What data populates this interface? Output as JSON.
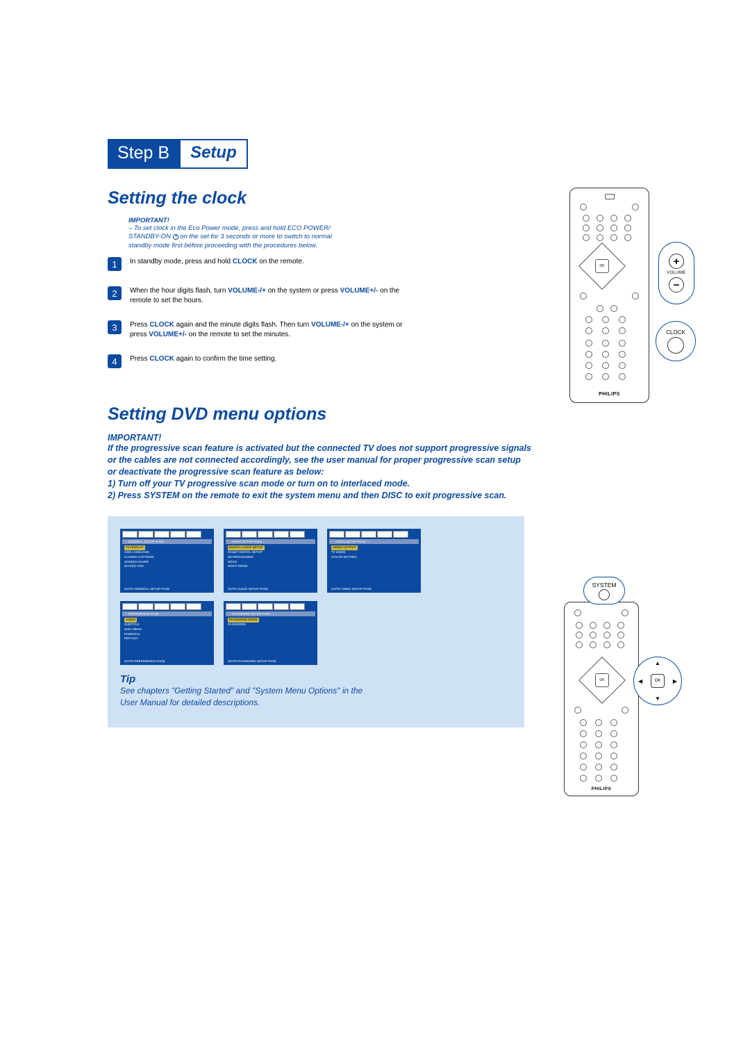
{
  "step_badge": {
    "left": "Step B",
    "right": "Setup"
  },
  "clock": {
    "heading": "Setting the clock",
    "important_label": "IMPORTANT!",
    "important_text_1": "– To set clock in the Eco Power mode, press and hold ECO POWER/",
    "important_text_2a": "STANDBY-ON ",
    "important_text_2b": " on the set for 3 seconds or more to switch to normal",
    "important_text_3": "standby mode first before proceeding with the procedures below.",
    "steps": {
      "s1a": "In standby mode, press and hold ",
      "s1b": "CLOCK",
      "s1c": " on the remote.",
      "s2a": "When the hour digits flash, turn ",
      "s2b": "VOLUME-/+",
      "s2c": " on the system or press ",
      "s2d": "VOLUME+/-",
      "s2e": " on the remote to set the hours.",
      "s3a": "Press ",
      "s3b": "CLOCK",
      "s3c": " again and the minute digits flash. Then turn ",
      "s3d": "VOLUME-/+",
      "s3e": " on the system or press ",
      "s3f": "VOLUME+/-",
      "s3g": " on the remote to set the minutes.",
      "s4a": "Press ",
      "s4b": "CLOCK",
      "s4c": " again to confirm the time setting."
    },
    "nums": {
      "n1": "1",
      "n2": "2",
      "n3": "3",
      "n4": "4"
    },
    "remote_brand": "PHILIPS",
    "ok_label": "OK",
    "volume_label": "VOLUME",
    "plus": "+",
    "minus": "−",
    "clock_label": "CLOCK"
  },
  "dvd": {
    "heading": "Setting DVD menu options",
    "important_label": "IMPORTANT!",
    "p1": "If the progressive scan feature is activated but the connected TV does not support progressive signals or the cables are not connected accordingly, see the user manual for proper progressive scan setup or deactivate the progressive scan feature as below:",
    "p2": "1) Turn off your TV progressive scan mode or turn on to interlaced mode.",
    "p3": "2) Press SYSTEM on the remote to exit the system menu and then DISC to exit progressive scan.",
    "system_label": "SYSTEM",
    "ok_label": "OK",
    "remote_brand": "PHILIPS",
    "panels": {
      "general": {
        "title": "- - GENERAL SETUP PAGE - -",
        "items": [
          "TV DISPLAY",
          "OSD LANGUAGE",
          "CLOSED CAPTIONS",
          "SCREEN SAVER",
          "DIVX(R) VOD"
        ],
        "footer": "GOTO GENERAL SETUP PAGE"
      },
      "audio": {
        "title": "- - AUDIO SETUP PAGE - -",
        "items": [
          "DIGITAL AUDIO SETUP",
          "DOLBY DIGITAL SETUP",
          "3D PROCESSING",
          "HDCD",
          "NIGHT MODE"
        ],
        "footer": "GOTO AUDIO SETUP PAGE"
      },
      "video": {
        "title": "- - VIDEO SETUP PAGE - -",
        "items": [
          "VIDEO OUTPUT",
          "TV MODE",
          "COLOR SETTING"
        ],
        "footer": "GOTO VIDEO SETUP PAGE"
      },
      "preference": {
        "title": "- - PREFERENCE PAGE - -",
        "items": [
          "AUDIO",
          "SUBTITLE",
          "DISC MENU",
          "PARENTAL",
          "DEFAULT"
        ],
        "footer": "GOTO PREFERENCE PAGE"
      },
      "password": {
        "title": "- - PASSWORD SETUP PAGE - -",
        "items": [
          "PASSWORD MODE",
          "PASSWORD"
        ],
        "footer": "GOTO PASSWORD SETUP PAGE"
      }
    },
    "tip_title": "Tip",
    "tip_body_1": "See chapters \"Getting Started\" and \"System Menu Options\" in the",
    "tip_body_2": "User Manual for detailed descriptions."
  }
}
